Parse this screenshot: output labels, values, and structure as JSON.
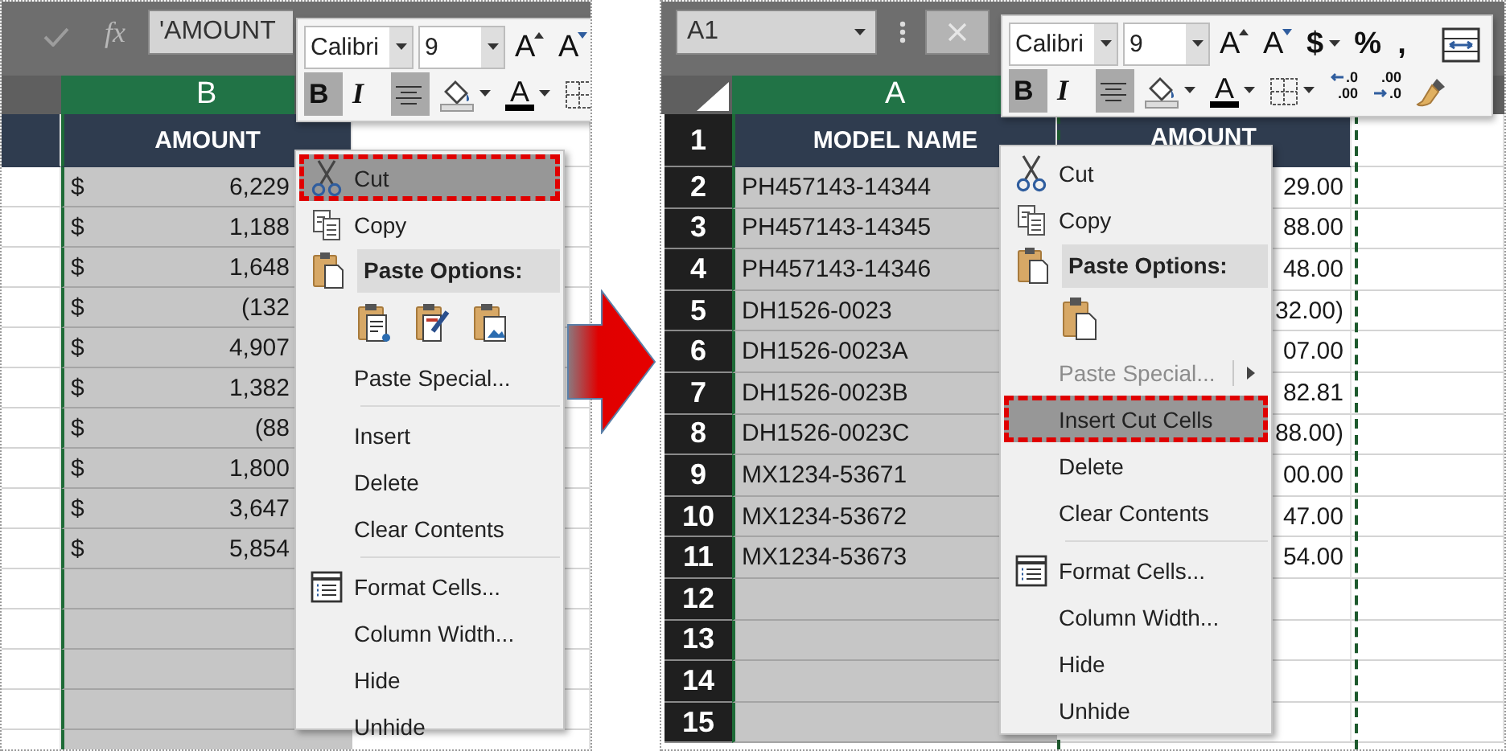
{
  "panes": [
    {
      "kind": "amount-column",
      "formula_bar": {
        "function_label": "fx",
        "formula": "'AMOUNT"
      },
      "column_header": {
        "label": "B",
        "selected": true
      },
      "table": {
        "header": "AMOUNT",
        "rows": [
          {
            "symbol": "$",
            "amount": "6,229"
          },
          {
            "symbol": "$",
            "amount": "1,188"
          },
          {
            "symbol": "$",
            "amount": "1,648"
          },
          {
            "symbol": "$",
            "amount": "(132"
          },
          {
            "symbol": "$",
            "amount": "4,907"
          },
          {
            "symbol": "$",
            "amount": "1,382"
          },
          {
            "symbol": "$",
            "amount": "(88"
          },
          {
            "symbol": "$",
            "amount": "1,800"
          },
          {
            "symbol": "$",
            "amount": "3,647"
          },
          {
            "symbol": "$",
            "amount": "5,854"
          }
        ]
      },
      "toolbar": {
        "font_row": [
          {
            "kind": "font",
            "value": "Calibri"
          },
          {
            "kind": "size",
            "value": "9"
          },
          {
            "kind": "grow",
            "text": "A"
          },
          {
            "kind": "shrink",
            "text": "A"
          }
        ],
        "format_row": [
          {
            "kind": "bold",
            "text": "B",
            "on": true
          },
          {
            "kind": "italic",
            "text": "I",
            "on": false
          },
          {
            "kind": "align",
            "on": true
          },
          {
            "kind": "fill",
            "dropdown": true
          },
          {
            "kind": "font-color",
            "text": "A",
            "dropdown": true
          },
          {
            "kind": "borders",
            "dropdown": false
          }
        ]
      },
      "menu": {
        "items": [
          {
            "kind": "cut",
            "label": "Cut",
            "selected": true,
            "disabled": false,
            "submenu": false
          },
          {
            "kind": "copy",
            "label": "Copy",
            "selected": false,
            "disabled": false,
            "submenu": false
          },
          {
            "kind": "header",
            "label": "Paste Options:"
          },
          {
            "kind": "paste-buttons",
            "buttons": [
              {
                "kind": "values"
              },
              {
                "kind": "formatting"
              },
              {
                "kind": "picture"
              }
            ]
          },
          {
            "kind": "command",
            "label": "Paste Special...",
            "selected": false,
            "disabled": false,
            "submenu": false
          },
          {
            "kind": "separator"
          },
          {
            "kind": "command",
            "label": "Insert",
            "selected": false,
            "disabled": false,
            "submenu": false
          },
          {
            "kind": "command",
            "label": "Delete",
            "selected": false,
            "disabled": false,
            "submenu": false
          },
          {
            "kind": "command",
            "label": "Clear Contents",
            "selected": false,
            "disabled": false,
            "submenu": false
          },
          {
            "kind": "separator"
          },
          {
            "kind": "format",
            "label": "Format Cells...",
            "selected": false,
            "disabled": false,
            "submenu": false
          },
          {
            "kind": "command",
            "label": "Column Width...",
            "selected": false,
            "disabled": false,
            "submenu": false
          },
          {
            "kind": "command",
            "label": "Hide",
            "selected": false,
            "disabled": false,
            "submenu": false
          },
          {
            "kind": "command",
            "label": "Unhide",
            "selected": false,
            "disabled": false,
            "submenu": false
          }
        ]
      }
    },
    {
      "kind": "model-sheet",
      "formula_bar": {
        "name_box": "A1"
      },
      "column_header": {
        "label": "A",
        "selected": true
      },
      "row_numbers": [
        "1",
        "2",
        "3",
        "4",
        "5",
        "6",
        "7",
        "8",
        "9",
        "10",
        "11",
        "12",
        "13",
        "14",
        "15"
      ],
      "table": {
        "columns": [
          {
            "header": "MODEL NAME",
            "cut": false
          },
          {
            "header": "AMOUNT",
            "cut": true
          }
        ],
        "rows": [
          {
            "model": "PH457143-14344",
            "amount": "29.00"
          },
          {
            "model": "PH457143-14345",
            "amount": "88.00"
          },
          {
            "model": "PH457143-14346",
            "amount": "48.00"
          },
          {
            "model": "DH1526-0023",
            "amount": "32.00)"
          },
          {
            "model": "DH1526-0023A",
            "amount": "07.00"
          },
          {
            "model": "DH1526-0023B",
            "amount": "82.81"
          },
          {
            "model": "DH1526-0023C",
            "amount": "88.00)"
          },
          {
            "model": "MX1234-53671",
            "amount": "00.00"
          },
          {
            "model": "MX1234-53672",
            "amount": "47.00"
          },
          {
            "model": "MX1234-53673",
            "amount": "54.00"
          }
        ]
      },
      "toolbar": {
        "font_row": [
          {
            "kind": "font",
            "value": "Calibri"
          },
          {
            "kind": "size",
            "value": "9"
          },
          {
            "kind": "grow",
            "text": "A"
          },
          {
            "kind": "shrink",
            "text": "A"
          },
          {
            "kind": "currency",
            "text": "$",
            "dropdown": true
          },
          {
            "kind": "percent",
            "text": "%"
          },
          {
            "kind": "comma",
            "text": ","
          },
          {
            "kind": "wrap"
          }
        ],
        "format_row": [
          {
            "kind": "bold",
            "text": "B",
            "on": true
          },
          {
            "kind": "italic",
            "text": "I",
            "on": false
          },
          {
            "kind": "align",
            "on": true
          },
          {
            "kind": "fill",
            "dropdown": true
          },
          {
            "kind": "font-color",
            "text": "A",
            "dropdown": true
          },
          {
            "kind": "borders",
            "dropdown": true
          },
          {
            "kind": "add-decimal",
            "top": ".0",
            "bottom": ".00"
          },
          {
            "kind": "remove-decimal",
            "top": ".00",
            "bottom": ".0"
          },
          {
            "kind": "painter"
          }
        ]
      },
      "menu": {
        "items": [
          {
            "kind": "cut",
            "label": "Cut",
            "selected": false,
            "disabled": false,
            "submenu": false
          },
          {
            "kind": "copy",
            "label": "Copy",
            "selected": false,
            "disabled": false,
            "submenu": false
          },
          {
            "kind": "header",
            "label": "Paste Options:"
          },
          {
            "kind": "paste-buttons",
            "buttons": [
              {
                "kind": "paste"
              }
            ]
          },
          {
            "kind": "command",
            "label": "Paste Special...",
            "selected": false,
            "disabled": true,
            "submenu": true
          },
          {
            "kind": "command",
            "label": "Insert Cut Cells",
            "selected": true,
            "disabled": false,
            "submenu": false
          },
          {
            "kind": "command",
            "label": "Delete",
            "selected": false,
            "disabled": false,
            "submenu": false
          },
          {
            "kind": "command",
            "label": "Clear Contents",
            "selected": false,
            "disabled": false,
            "submenu": false
          },
          {
            "kind": "separator"
          },
          {
            "kind": "format",
            "label": "Format Cells...",
            "selected": false,
            "disabled": false,
            "submenu": false
          },
          {
            "kind": "command",
            "label": "Column Width...",
            "selected": false,
            "disabled": false,
            "submenu": false
          },
          {
            "kind": "command",
            "label": "Hide",
            "selected": false,
            "disabled": false,
            "submenu": false
          },
          {
            "kind": "command",
            "label": "Unhide",
            "selected": false,
            "disabled": false,
            "submenu": false
          }
        ]
      }
    }
  ]
}
